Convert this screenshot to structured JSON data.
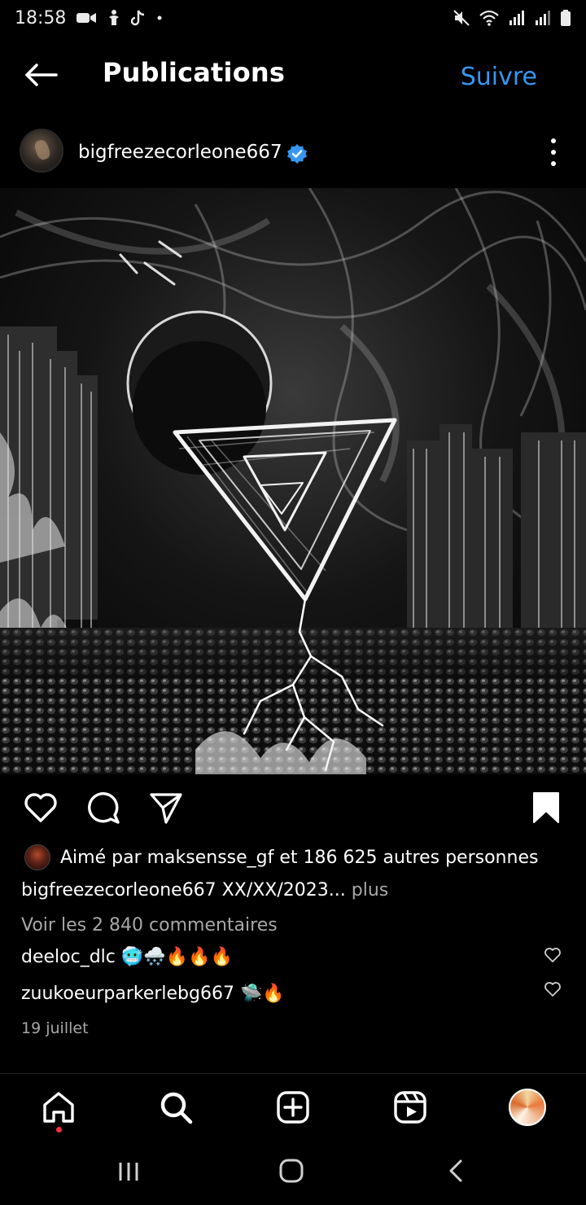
{
  "status_bar": {
    "time": "18:58",
    "left_icons": [
      "video-call-icon",
      "accessibility-icon",
      "tiktok-icon",
      "dot-icon"
    ],
    "right_icons": [
      "mute-icon",
      "wifi-icon",
      "signal-icon",
      "signal-icon-2",
      "battery-icon"
    ]
  },
  "topbar": {
    "back_icon": "arrow-left-icon",
    "title": "Publications",
    "follow_label": "Suivre"
  },
  "post": {
    "username": "bigfreezecorleone667",
    "verified": true,
    "more_icon": "more-vertical-icon",
    "image_alt": "Monochrome surreal artwork with a glowing triangle, moon and ruined city"
  },
  "actions": {
    "icons": [
      "heart-icon",
      "comment-icon",
      "share-icon",
      "bookmark-icon"
    ]
  },
  "likes": {
    "text": "Aimé par maksensse_gf et 186 625 autres personnes"
  },
  "caption": {
    "username": "bigfreezecorleone667",
    "text": " XX/XX/2023...",
    "more_label": " plus"
  },
  "comments": {
    "view_all": "Voir les 2 840 commentaires",
    "items": [
      {
        "username": "deeloc_dlc",
        "text": "🥶🌨️🔥🔥🔥"
      },
      {
        "username": "zuukoeurparkerlebg667",
        "text": "🛸🔥"
      }
    ]
  },
  "date": "19 juillet",
  "bottom_nav": {
    "items": [
      "home-icon",
      "search-icon",
      "create-icon",
      "reels-icon",
      "profile-avatar"
    ]
  },
  "system_nav": {
    "items": [
      "recents-icon",
      "home-circle-icon",
      "back-chevron-icon"
    ]
  },
  "colors": {
    "background": "#000000",
    "accent_blue": "#3797f0",
    "secondary_text": "#a8a8a8",
    "notification_red": "#ff3040"
  }
}
